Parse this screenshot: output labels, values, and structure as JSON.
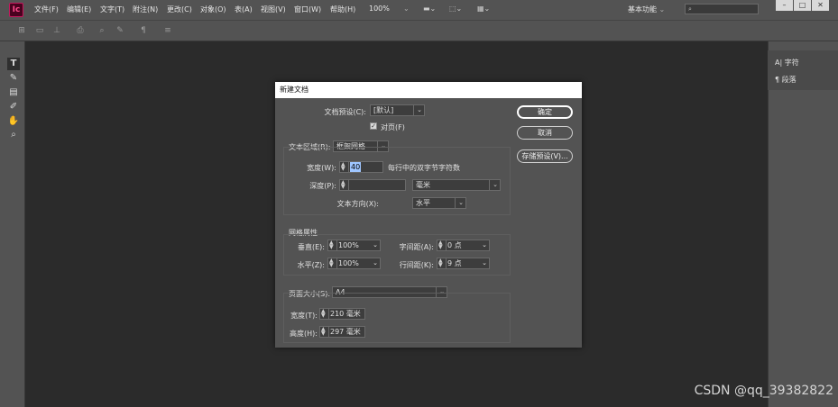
{
  "app": {
    "logo_text": "Ic",
    "brand_color": "#c3195d"
  },
  "menu": [
    "文件(F)",
    "编辑(E)",
    "文字(T)",
    "附注(N)",
    "更改(C)",
    "对象(O)",
    "表(A)",
    "视图(V)",
    "窗口(W)",
    "帮助(H)"
  ],
  "zoom": "100%",
  "workspace": "基本功能",
  "window_controls": [
    "–",
    "□",
    "✕"
  ],
  "panels": {
    "character": "字符",
    "paragraph": "段落"
  },
  "dialog": {
    "title": "新建文档",
    "preset_label": "文档预设(C):",
    "preset_value": "[默认]",
    "facing_pages_label": "对页(F)",
    "facing_pages_checked": true,
    "text_area_label": "文本区域(R):",
    "text_area_value": "框架网格",
    "width_label": "宽度(W):",
    "width_value": "40",
    "width_hint": "每行中的双字节字符数",
    "depth_label": "深度(P):",
    "depth_value": "",
    "depth_unit": "毫米",
    "text_direction_label": "文本方向(X):",
    "text_direction_value": "水平",
    "grid_attr_title": "网格属性",
    "vertical_label": "垂直(E):",
    "vertical_value": "100%",
    "horizontal_label": "水平(Z):",
    "horizontal_value": "100%",
    "char_spacing_label": "字间距(A):",
    "char_spacing_value": "0 点",
    "line_spacing_label": "行间距(K):",
    "line_spacing_value": "9 点",
    "page_size_label": "页面大小(S):",
    "page_size_value": "A4",
    "page_width_label": "宽度(T):",
    "page_width_value": "210 毫米",
    "page_height_label": "高度(H):",
    "page_height_value": "297 毫米",
    "ok_label": "确定",
    "cancel_label": "取消",
    "save_preset_label": "存储预设(V)..."
  },
  "watermark": "CSDN @qq_39382822"
}
